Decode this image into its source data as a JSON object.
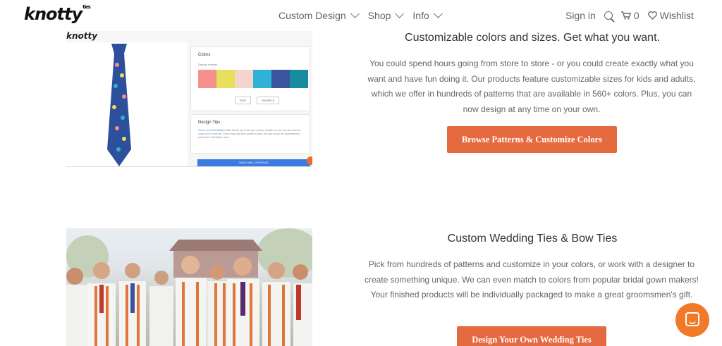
{
  "header": {
    "logo": "knotty",
    "logo_sup": "ties",
    "nav": [
      {
        "label": "Custom Design"
      },
      {
        "label": "Shop"
      },
      {
        "label": "Info"
      }
    ],
    "sign_in": "Sign in",
    "cart_count": "0",
    "wishlist": "Wishlist"
  },
  "section1": {
    "heading": "Customizable colors and sizes. Get what you want.",
    "body": "You could spend hours going from store to store - or you could create exactly what you want and have fun doing it. Our products feature customizable sizes for kids and adults, which we offer in hundreds of patterns that are available in 560+ colors. Plus, you can now design at any time on your own.",
    "button": "Browse Patterns & Customize Colors",
    "mock": {
      "logo": "knotty",
      "colors_title": "Colors",
      "drag_label": "Drag to reorder",
      "swatches": [
        "#f48f8b",
        "#e6e05a",
        "#f7d4cb",
        "#2eb3d6",
        "#3b54a0",
        "#188c9f"
      ],
      "edit_btn": "EDIT",
      "shuffle_btn": "SHUFFLE",
      "tips_title": "Design Tips",
      "tips_link": "Check out a ColorMatch Chart",
      "tips_text": "before you order your custom neckties so you can see how the colors look in real life. Colors may vary from screen to print, but your colors are guaranteed to match the ColorMatch chart.",
      "save_btn": "SAVE AND CONTINUE"
    }
  },
  "section2": {
    "heading": "Custom Wedding Ties & Bow Ties",
    "body": "Pick from hundreds of patterns and customize in your colors, or work with a designer to create something unique. We can even match to colors from popular bridal gown makers! Your finished products will be individually packaged to make a great groomsmen's gift.",
    "button": "Design Your Own Wedding Ties"
  },
  "colors": {
    "accent": "#e66a3f",
    "chat": "#f07a28"
  }
}
